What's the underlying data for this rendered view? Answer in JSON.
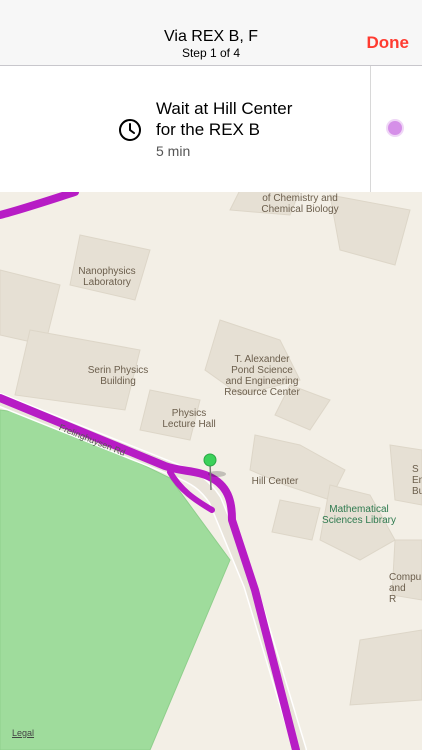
{
  "nav": {
    "title": "Via REX B, F",
    "subtitle": "Step 1 of 4",
    "done_label": "Done"
  },
  "step": {
    "line1": "Wait at Hill Center",
    "line2": "for the REX B",
    "time": "5 min",
    "icon": "clock-icon"
  },
  "map": {
    "labels": {
      "chemistry": [
        "of Chemistry and",
        "Chemical Biology"
      ],
      "nanophysics": [
        "Nanophysics",
        "Laboratory"
      ],
      "serin": [
        "Serin Physics",
        "Building"
      ],
      "pond": [
        "T. Alexander",
        "Pond Science",
        "and Engineering",
        "Resource Center"
      ],
      "lecture": [
        "Physics",
        "Lecture Hall"
      ],
      "hill": "Hill Center",
      "math": [
        "Mathematical",
        "Sciences Library"
      ],
      "right_top": [
        "S",
        "En",
        "Build"
      ],
      "right_bottom": [
        "Compu",
        "and",
        "R"
      ],
      "road": "Frelinghuysen Rd"
    },
    "legal": "Legal",
    "route_color": "#b71cc5",
    "park_color": "#9fdc9c",
    "pin_color": "#3bd15a"
  }
}
